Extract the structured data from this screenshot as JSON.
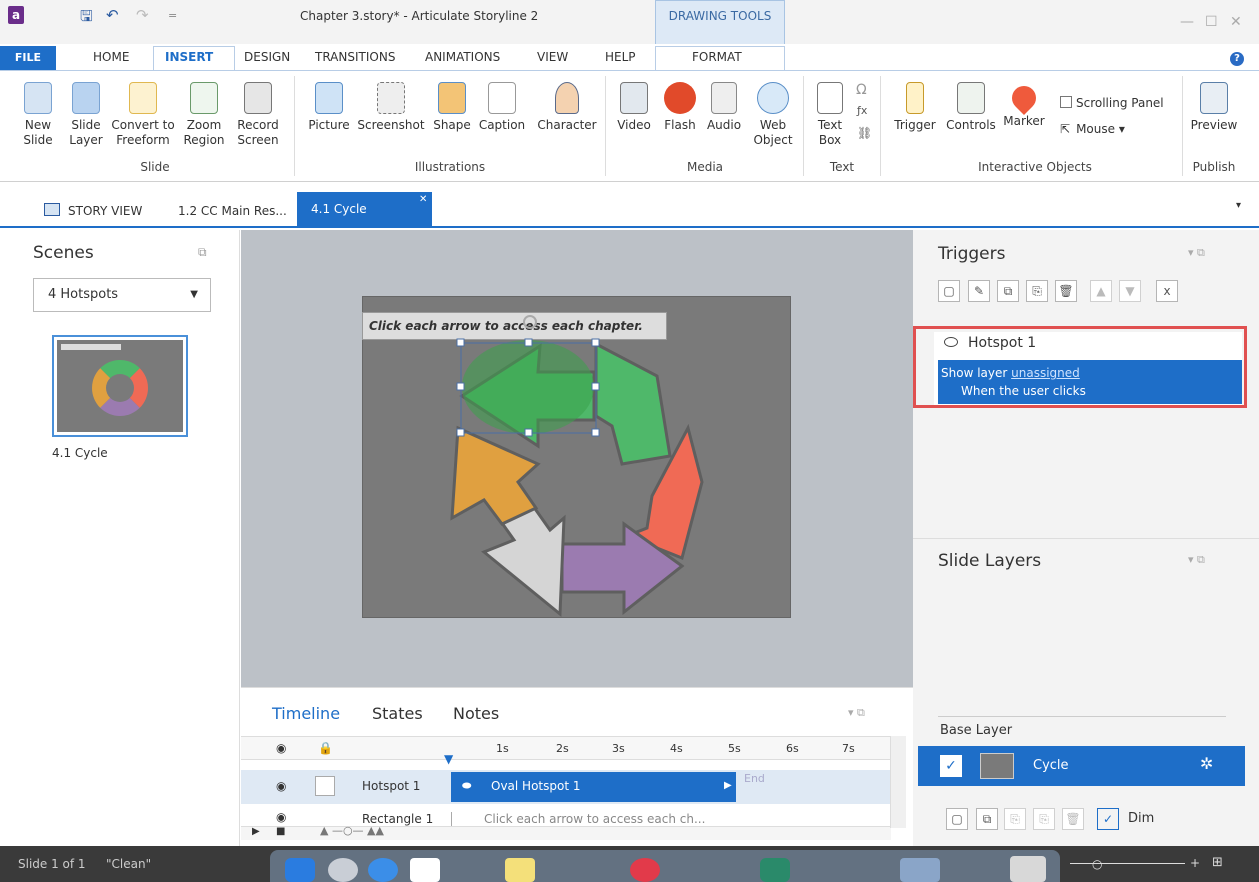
{
  "window": {
    "title": "Chapter 3.story* - Articulate Storyline 2",
    "contextual_tab_group": "DRAWING TOOLS"
  },
  "ribbon_tabs": [
    {
      "label": "FILE"
    },
    {
      "label": "HOME"
    },
    {
      "label": "INSERT"
    },
    {
      "label": "DESIGN"
    },
    {
      "label": "TRANSITIONS"
    },
    {
      "label": "ANIMATIONS"
    },
    {
      "label": "VIEW"
    },
    {
      "label": "HELP"
    },
    {
      "label": "FORMAT"
    }
  ],
  "ribbon": {
    "slide": {
      "group": "Slide",
      "new_slide": "New Slide",
      "slide_layer": "Slide Layer",
      "convert": "Convert to Freeform",
      "zoom": "Zoom Region",
      "record": "Record Screen"
    },
    "illustrations": {
      "group": "Illustrations",
      "picture": "Picture",
      "screenshot": "Screenshot",
      "shape": "Shape",
      "caption": "Caption",
      "character": "Character"
    },
    "media": {
      "group": "Media",
      "video": "Video",
      "flash": "Flash",
      "audio": "Audio",
      "web": "Web Object"
    },
    "text": {
      "group": "Text",
      "textbox": "Text Box"
    },
    "interactive": {
      "group": "Interactive Objects",
      "trigger": "Trigger",
      "controls": "Controls",
      "marker": "Marker",
      "scrolling_panel": "Scrolling Panel",
      "mouse": "Mouse"
    },
    "publish": {
      "group": "Publish",
      "preview": "Preview"
    }
  },
  "doc_tabs": {
    "story_view": "STORY VIEW",
    "tab1": "1.2 CC Main Res...",
    "active": "4.1 Cycle"
  },
  "scenes": {
    "title": "Scenes",
    "selected": "4 Hotspots",
    "thumb_label": "4.1 Cycle"
  },
  "slide": {
    "caption": "Click each arrow to access each chapter."
  },
  "triggers": {
    "title": "Triggers",
    "item_name": "Hotspot 1",
    "action_prefix": "Show layer",
    "action_link": "unassigned",
    "condition": "When the user clicks"
  },
  "layers": {
    "title": "Slide Layers",
    "base_layer": "Base Layer",
    "layer_name": "Cycle",
    "dim_label": "Dim"
  },
  "timeline": {
    "tabs": [
      "Timeline",
      "States",
      "Notes"
    ],
    "ticks": [
      "1s",
      "2s",
      "3s",
      "4s",
      "5s",
      "6s",
      "7s"
    ],
    "rows": [
      {
        "name": "Hotspot 1",
        "bar": "Oval Hotspot 1",
        "end": "End"
      },
      {
        "name": "Rectangle 1",
        "bar": "Click each arrow to access each ch..."
      }
    ]
  },
  "status": {
    "slide": "Slide 1 of 1",
    "theme": "\"Clean\""
  },
  "colors": {
    "accent": "#1e6ec8",
    "highlight_box": "#e05050"
  }
}
